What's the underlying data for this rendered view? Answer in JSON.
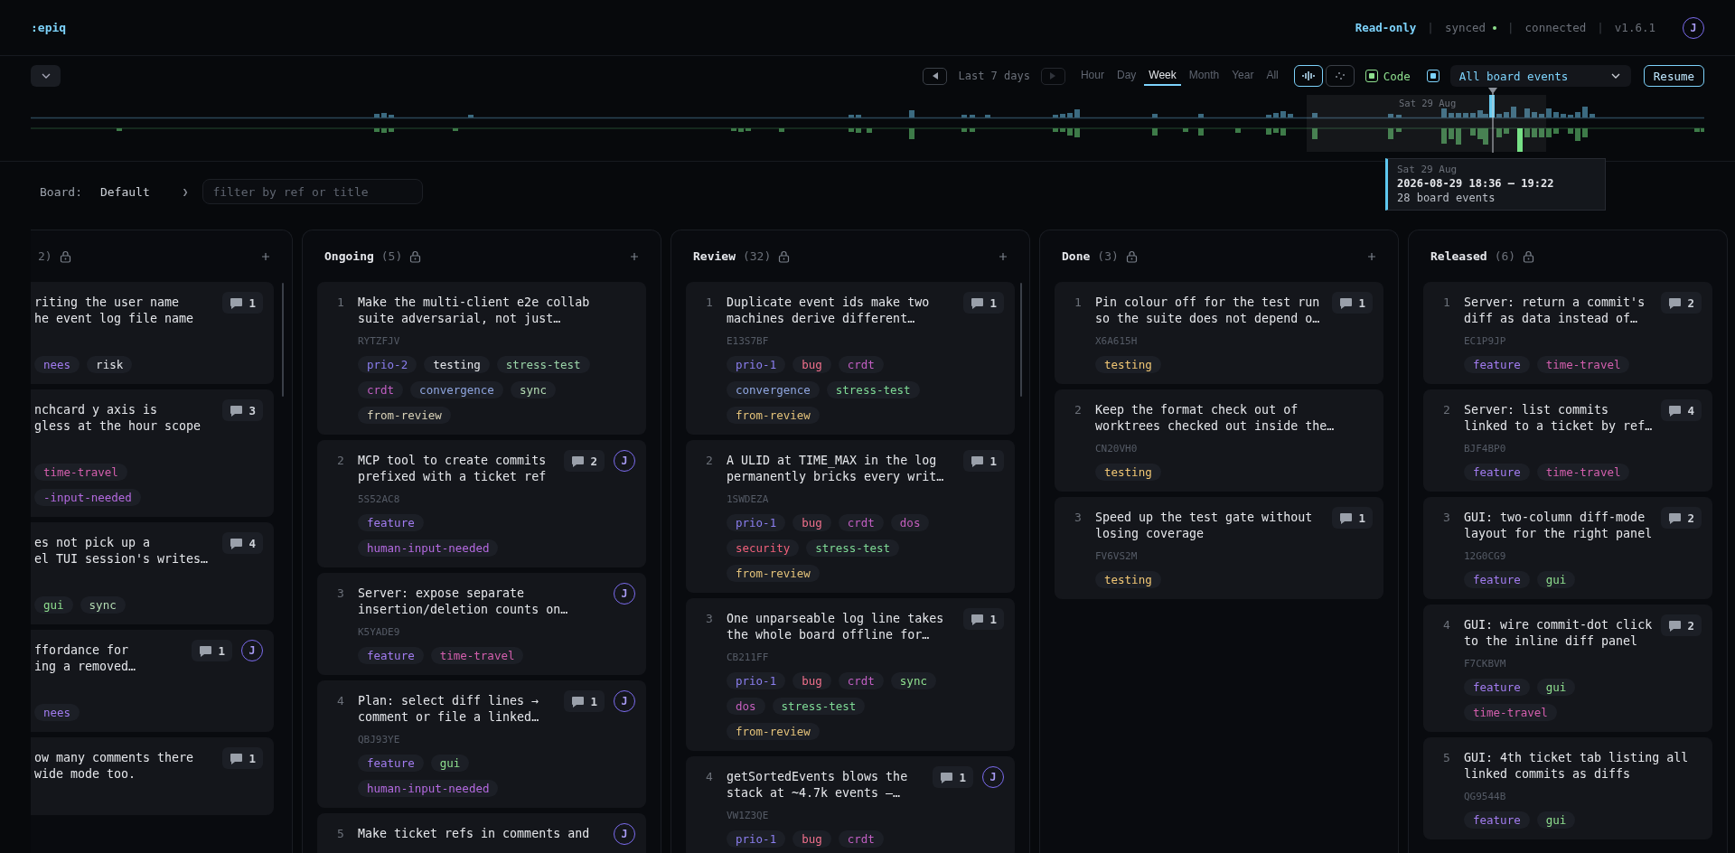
{
  "header": {
    "logo": ":epiq",
    "status_items": [
      {
        "kind": "mode",
        "text": "Read-only"
      },
      {
        "kind": "separator",
        "text": "|"
      },
      {
        "kind": "status",
        "text": "synced",
        "live": true
      },
      {
        "kind": "separator",
        "text": "|"
      },
      {
        "kind": "status",
        "text": "connected",
        "live": false
      },
      {
        "kind": "separator",
        "text": "|"
      },
      {
        "kind": "version",
        "text": "v1.6.1"
      }
    ],
    "user_initial": "J"
  },
  "timeline": {
    "range_label": "Last 7 days",
    "prev_enabled": true,
    "next_enabled": false,
    "scales": [
      {
        "label": "Hour",
        "selected": false
      },
      {
        "label": "Day",
        "selected": false
      },
      {
        "label": "Week",
        "selected": true
      },
      {
        "label": "Month",
        "selected": false
      },
      {
        "label": "Year",
        "selected": false
      },
      {
        "label": "All",
        "selected": false
      }
    ],
    "views": [
      {
        "kind": "wave",
        "selected": true
      },
      {
        "kind": "scatter",
        "selected": false
      }
    ],
    "code_filter": {
      "label": "Code",
      "checked": true
    },
    "events_filter": {
      "checked": true,
      "value": "All board events"
    },
    "resume_label": "Resume",
    "selection_label": "Sat 29 Aug",
    "tooltip": {
      "date": "Sat 29 Aug",
      "range": "2026-08-29 18:36 – 19:22",
      "count": "28 board events"
    }
  },
  "filter": {
    "board_label": "Board:",
    "board_name": "Default",
    "separator": "❯",
    "placeholder": "filter by ref or title"
  },
  "board": {
    "columns": [
      {
        "kind": "partial",
        "count": "2)",
        "addable": true,
        "scrollable": true,
        "cards": [
          {
            "title_lines": [
              "riting the user name",
              "he event log file name"
            ],
            "comments": "1",
            "tags": [
              {
                "label": "nees",
                "color": "#a27cf0"
              },
              {
                "label": "risk",
                "color": "#e5e7eb"
              }
            ]
          },
          {
            "title_lines": [
              "nchcard y axis is",
              "gless at the hour scope"
            ],
            "comments": "3",
            "tags": [
              {
                "label": "time-travel",
                "color": "#d45fae"
              },
              {
                "label": "-input-needed",
                "color": "#b46ae0"
              }
            ]
          },
          {
            "title_lines": [
              "es not pick up a",
              "el TUI session's writes…"
            ],
            "comments": "4",
            "tags": [
              {
                "label": "gui",
                "color": "#8fe08f"
              },
              {
                "label": "sync",
                "color": "#b4dcb4"
              }
            ]
          },
          {
            "title_lines": [
              "ffordance for",
              "ing a removed…"
            ],
            "comments": "1",
            "assignee": "J",
            "tags": [
              {
                "label": "nees",
                "color": "#a27cf0"
              }
            ]
          },
          {
            "title_lines": [
              "ow many comments there",
              "wide mode too."
            ],
            "comments": "1"
          }
        ]
      },
      {
        "kind": "full",
        "title": "Ongoing",
        "count": "(5)",
        "addable": true,
        "cards": [
          {
            "number": "1",
            "title_lines": [
              "Make the multi-client e2e collab",
              "suite adversarial, not just…"
            ],
            "ref": "RYTZFJV",
            "tags": [
              {
                "label": "prio-2",
                "color": "#8b7ff0"
              },
              {
                "label": "testing",
                "color": "#e5e7eb"
              },
              {
                "label": "stress-test",
                "color": "#9ad4a8"
              },
              {
                "label": "crdt",
                "color": "#c25fc4"
              },
              {
                "label": "convergence",
                "color": "#8fa6e0"
              },
              {
                "label": "sync",
                "color": "#b4dcb4"
              },
              {
                "label": "from-review",
                "color": "#d9d2b8"
              }
            ]
          },
          {
            "number": "2",
            "title_lines": [
              "MCP tool to create commits",
              "prefixed with a ticket ref"
            ],
            "ref": "5S52AC8",
            "comments": "2",
            "assignee": "J",
            "tags": [
              {
                "label": "feature",
                "color": "#a27cf0"
              },
              {
                "label": "human-input-needed",
                "color": "#b46ae0"
              }
            ]
          },
          {
            "number": "3",
            "title_lines": [
              "Server: expose separate",
              "insertion/deletion counts on…"
            ],
            "ref": "K5YADE9",
            "assignee": "J",
            "tags": [
              {
                "label": "feature",
                "color": "#a27cf0"
              },
              {
                "label": "time-travel",
                "color": "#d45fae"
              }
            ]
          },
          {
            "number": "4",
            "title_lines": [
              "Plan: select diff lines →",
              "comment or file a linked…"
            ],
            "ref": "QBJ93YE",
            "comments": "1",
            "assignee": "J",
            "tags": [
              {
                "label": "feature",
                "color": "#a27cf0"
              },
              {
                "label": "gui",
                "color": "#8fe08f"
              },
              {
                "label": "human-input-needed",
                "color": "#b46ae0"
              }
            ]
          },
          {
            "number": "5",
            "title_lines": [
              "Make ticket refs in comments and"
            ],
            "assignee": "J"
          }
        ]
      },
      {
        "kind": "full",
        "title": "Review",
        "count": "(32)",
        "addable": true,
        "scrollable": true,
        "cards": [
          {
            "number": "1",
            "title_lines": [
              "Duplicate event ids make two",
              "machines derive different…"
            ],
            "ref": "E13S7BF",
            "comments": "1",
            "tags": [
              {
                "label": "prio-1",
                "color": "#8b7ff0"
              },
              {
                "label": "bug",
                "color": "#f0708c"
              },
              {
                "label": "crdt",
                "color": "#c25fc4"
              },
              {
                "label": "convergence",
                "color": "#8fa6e0"
              },
              {
                "label": "stress-test",
                "color": "#7ed995"
              },
              {
                "label": "from-review",
                "color": "#e3c27a"
              }
            ]
          },
          {
            "number": "2",
            "title_lines": [
              "A ULID at TIME_MAX in the log",
              "permanently bricks every writ…"
            ],
            "ref": "1SWDEZA",
            "comments": "1",
            "tags": [
              {
                "label": "prio-1",
                "color": "#8b7ff0"
              },
              {
                "label": "bug",
                "color": "#f0708c"
              },
              {
                "label": "crdt",
                "color": "#c25fc4"
              },
              {
                "label": "dos",
                "color": "#c55fbe"
              },
              {
                "label": "security",
                "color": "#f0607a"
              },
              {
                "label": "stress-test",
                "color": "#7ed995"
              },
              {
                "label": "from-review",
                "color": "#e3c27a"
              }
            ]
          },
          {
            "number": "3",
            "title_lines": [
              "One unparseable log line takes",
              "the whole board offline for…"
            ],
            "ref": "CB211FF",
            "comments": "1",
            "tags": [
              {
                "label": "prio-1",
                "color": "#8b7ff0"
              },
              {
                "label": "bug",
                "color": "#f0708c"
              },
              {
                "label": "crdt",
                "color": "#c25fc4"
              },
              {
                "label": "sync",
                "color": "#8fe08f"
              },
              {
                "label": "dos",
                "color": "#c55fbe"
              },
              {
                "label": "stress-test",
                "color": "#7ed995"
              },
              {
                "label": "from-review",
                "color": "#e3c27a"
              }
            ]
          },
          {
            "number": "4",
            "title_lines": [
              "getSortedEvents blows the",
              "stack at ~4.7k events —…"
            ],
            "ref": "VW1Z3QE",
            "comments": "1",
            "assignee": "J",
            "tags": [
              {
                "label": "prio-1",
                "color": "#8b7ff0"
              },
              {
                "label": "bug",
                "color": "#f0708c"
              },
              {
                "label": "crdt",
                "color": "#c25fc4"
              }
            ]
          }
        ]
      },
      {
        "kind": "full",
        "title": "Done",
        "count": "(3)",
        "addable": true,
        "cards": [
          {
            "number": "1",
            "title_lines": [
              "Pin colour off for the test run",
              "so the suite does not depend o…"
            ],
            "ref": "X6A615H",
            "comments": "1",
            "tags": [
              {
                "label": "testing",
                "color": "#f0c674"
              }
            ]
          },
          {
            "number": "2",
            "title_lines": [
              "Keep the format check out of",
              "worktrees checked out inside the…"
            ],
            "ref": "CN20VH0",
            "tags": [
              {
                "label": "testing",
                "color": "#f0c674"
              }
            ]
          },
          {
            "number": "3",
            "title_lines": [
              "Speed up the test gate without",
              "losing coverage"
            ],
            "ref": "FV6VS2M",
            "comments": "1",
            "tags": [
              {
                "label": "testing",
                "color": "#f0c674"
              }
            ]
          }
        ]
      },
      {
        "kind": "full",
        "title": "Released",
        "count": "(6)",
        "cards": [
          {
            "number": "1",
            "title_lines": [
              "Server: return a commit's",
              "diff as data instead of…"
            ],
            "ref": "EC1P9JP",
            "comments": "2",
            "tags": [
              {
                "label": "feature",
                "color": "#a27cf0"
              },
              {
                "label": "time-travel",
                "color": "#d45fae"
              }
            ]
          },
          {
            "number": "2",
            "title_lines": [
              "Server: list commits",
              "linked to a ticket by ref…"
            ],
            "ref": "BJF4BP0",
            "comments": "4",
            "tags": [
              {
                "label": "feature",
                "color": "#a27cf0"
              },
              {
                "label": "time-travel",
                "color": "#d45fae"
              }
            ]
          },
          {
            "number": "3",
            "title_lines": [
              "GUI: two-column diff-mode",
              "layout for the right panel"
            ],
            "ref": "12G0CG9",
            "comments": "2",
            "tags": [
              {
                "label": "feature",
                "color": "#a27cf0"
              },
              {
                "label": "gui",
                "color": "#8fe08f"
              }
            ]
          },
          {
            "number": "4",
            "title_lines": [
              "GUI: wire commit-dot click",
              "to the inline diff panel"
            ],
            "ref": "F7CKBVM",
            "comments": "2",
            "tags": [
              {
                "label": "feature",
                "color": "#a27cf0"
              },
              {
                "label": "gui",
                "color": "#8fe08f"
              },
              {
                "label": "time-travel",
                "color": "#d45fae"
              }
            ]
          },
          {
            "number": "5",
            "title_lines": [
              "GUI: 4th ticket tab listing all",
              "linked commits as diffs"
            ],
            "ref": "QG9544B",
            "tags": [
              {
                "label": "feature",
                "color": "#a27cf0"
              },
              {
                "label": "gui",
                "color": "#8fe08f"
              }
            ]
          }
        ]
      }
    ]
  }
}
